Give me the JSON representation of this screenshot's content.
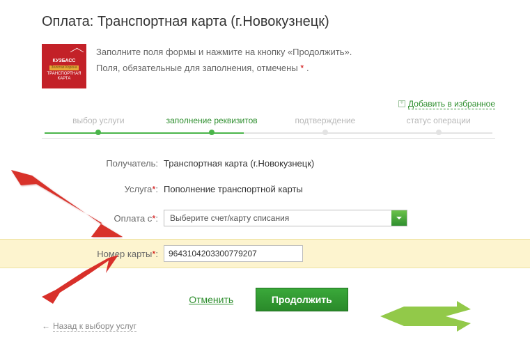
{
  "title": "Оплата: Транспортная карта (г.Новокузнецк)",
  "logo": {
    "line1": "КУЗБАСС",
    "line2": "Золотая Корона",
    "line3": "ТРАНСПОРТНАЯ",
    "line4": "КАРТА"
  },
  "intro": {
    "line1": "Заполните поля формы и нажмите на кнопку «Продолжить».",
    "line2_pre": "Поля, обязательные для заполнения, отмечены ",
    "line2_post": " ."
  },
  "favorite": "Добавить в избранное",
  "steps": {
    "s1": "выбор услуги",
    "s2": "заполнение реквизитов",
    "s3": "подтверждение",
    "s4": "статус операции"
  },
  "fields": {
    "recipient_label": "Получатель:",
    "recipient_value": "Транспортная карта (г.Новокузнецк)",
    "service_label": "Услуга",
    "service_value": "Пополнение транспортной карты",
    "payfrom_label": "Оплата с",
    "payfrom_value": "Выберите счет/карту списания",
    "cardnum_label": "Номер карты",
    "cardnum_value": "9643104203300779207"
  },
  "buttons": {
    "cancel": "Отменить",
    "continue": "Продолжить"
  },
  "back": "Назад к выбору услуг"
}
